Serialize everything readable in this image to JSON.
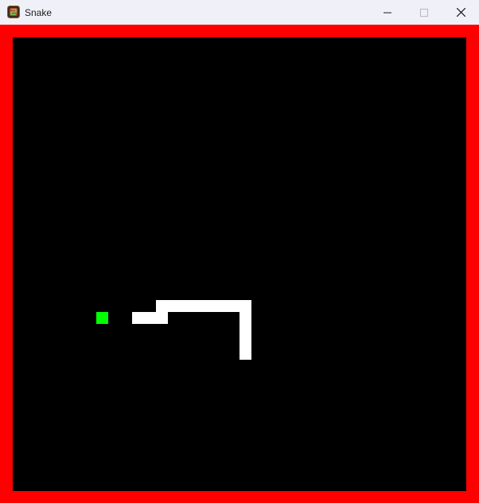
{
  "window": {
    "title": "Snake",
    "icon": "snake-app-icon",
    "controls": [
      "minimize-icon",
      "maximize-icon",
      "close-icon"
    ]
  },
  "game": {
    "grid_cols": 38,
    "grid_rows": 38,
    "snake_segments": [
      [
        10,
        23
      ],
      [
        11,
        23
      ],
      [
        12,
        23
      ],
      [
        12,
        22
      ],
      [
        13,
        22
      ],
      [
        14,
        22
      ],
      [
        15,
        22
      ],
      [
        16,
        22
      ],
      [
        17,
        22
      ],
      [
        18,
        22
      ],
      [
        19,
        22
      ],
      [
        19,
        23
      ],
      [
        19,
        24
      ],
      [
        19,
        25
      ],
      [
        19,
        26
      ]
    ],
    "food": [
      7,
      23
    ]
  },
  "colors": {
    "border": "#ff0000",
    "background": "#000000",
    "snake": "#ffffff",
    "food": "#00ff00"
  }
}
